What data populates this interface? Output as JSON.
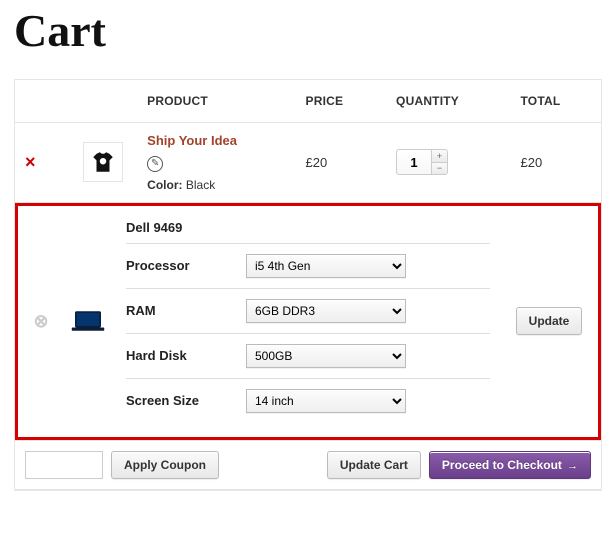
{
  "page": {
    "title": "Cart"
  },
  "headers": {
    "product": "PRODUCT",
    "price": "PRICE",
    "quantity": "QUANTITY",
    "total": "TOTAL"
  },
  "item_shirt": {
    "name": "Ship Your Idea",
    "variation_label": "Color:",
    "variation_value": "Black",
    "price": "£20",
    "qty": "1",
    "total": "£20"
  },
  "item_laptop": {
    "name": "Dell 9469",
    "specs": {
      "processor_label": "Processor",
      "processor_value": "i5 4th Gen",
      "ram_label": "RAM",
      "ram_value": "6GB DDR3",
      "harddisk_label": "Hard Disk",
      "harddisk_value": "500GB",
      "screen_label": "Screen Size",
      "screen_value": "14 inch"
    },
    "update_label": "Update"
  },
  "actions": {
    "apply_coupon": "Apply Coupon",
    "update_cart": "Update Cart",
    "checkout": "Proceed to Checkout"
  }
}
